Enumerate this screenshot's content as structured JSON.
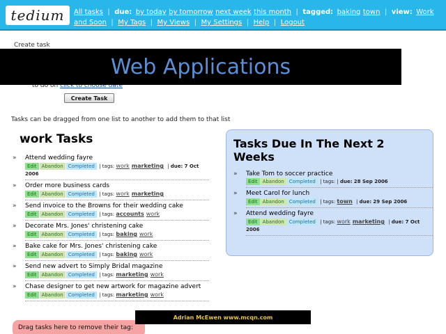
{
  "app": {
    "logo": "tedium"
  },
  "nav": {
    "all_tasks": "All tasks",
    "due_label": "due:",
    "due_items": [
      "by today",
      "by tomorrow",
      "next week",
      "this month"
    ],
    "tagged_label": "tagged:",
    "tagged_items": [
      "baking",
      "town"
    ],
    "view_label": "view:",
    "view_items": [
      "Work and Soon",
      "My Tags",
      "My Views",
      "My Settings",
      "Help",
      "Logout"
    ]
  },
  "form": {
    "line1": "Create task",
    "line2_prefix": "to do on",
    "line2_link": "click to choose date",
    "create_button": "Create Task"
  },
  "banner": {
    "text": "Web Applications"
  },
  "drag_hint": "Tasks can be dragged from one list to another to add them to that list",
  "labels": {
    "edit": "Edit",
    "abandon": "Abandon",
    "completed": "Completed",
    "tags": "tags:",
    "due": "due:"
  },
  "work": {
    "title": "work Tasks",
    "tasks": [
      {
        "title": "Attend wedding fayre",
        "tags": [
          "work",
          "marketing"
        ],
        "due": "7 Oct 2006"
      },
      {
        "title": "Order more business cards",
        "tags": [
          "work",
          "marketing"
        ]
      },
      {
        "title": "Send invoice to the Browns for their wedding cake",
        "tags": [
          "accounts",
          "work"
        ]
      },
      {
        "title": "Decorate Mrs. Jones' christening cake",
        "tags": [
          "baking",
          "work"
        ]
      },
      {
        "title": "Bake cake for Mrs. Jones' christening cake",
        "tags": [
          "baking",
          "work"
        ]
      },
      {
        "title": "Send new advert to Simply Bridal magazine",
        "tags": [
          "marketing",
          "work"
        ]
      },
      {
        "title": "Chase designer to get new artwork for magazine advert",
        "tags": [
          "marketing",
          "work"
        ]
      }
    ]
  },
  "due_soon": {
    "title": "Tasks Due In The Next 2 Weeks",
    "tasks": [
      {
        "title": "Take Tom to soccer practice",
        "tags": [],
        "due": "28 Sep 2006"
      },
      {
        "title": "Meet Carol for lunch",
        "tags": [
          "town"
        ],
        "due": "29 Sep 2006"
      },
      {
        "title": "Attend wedding fayre",
        "tags": [
          "work",
          "marketing"
        ],
        "due": "7 Oct 2006"
      }
    ]
  },
  "remove_zone": "Drag tasks here to remove their tag:",
  "credit": "Adrian McEwen  www.mcqn.com"
}
